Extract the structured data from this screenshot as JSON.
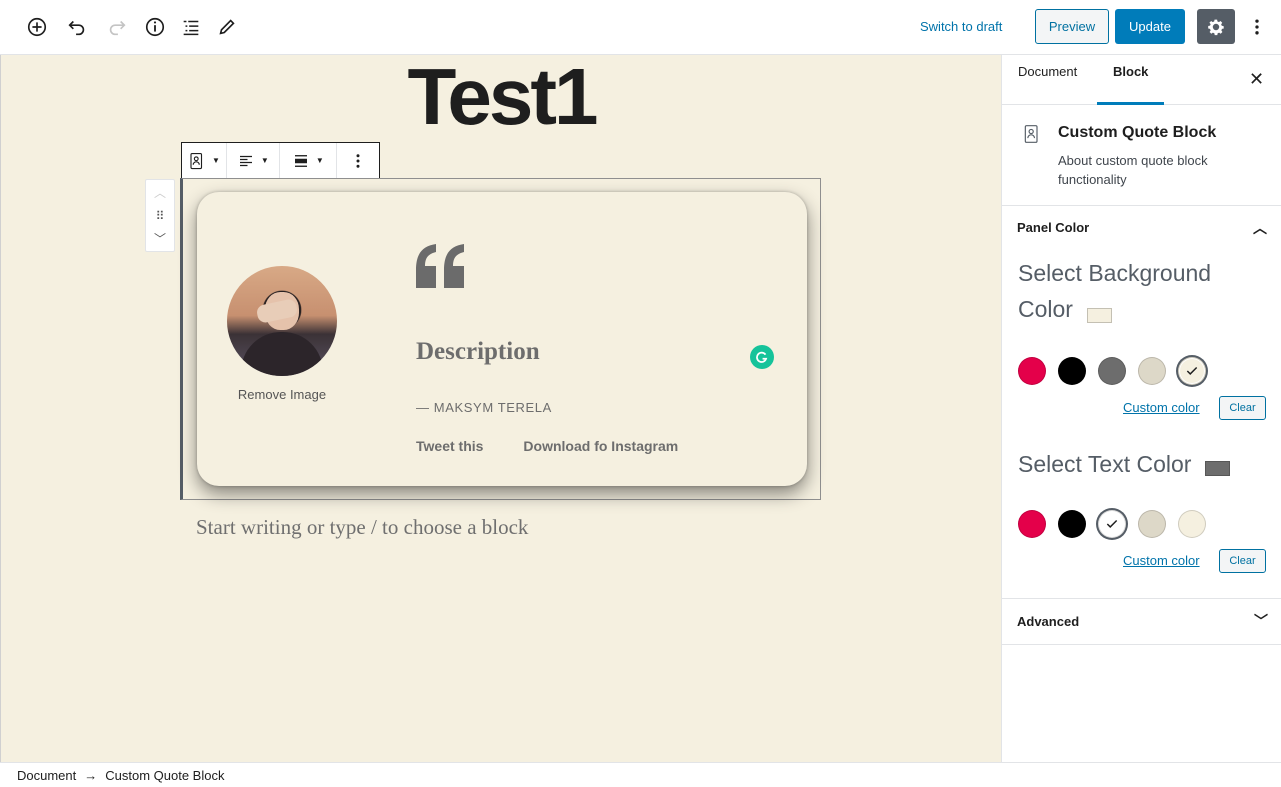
{
  "toolbar": {
    "switch_draft": "Switch to draft",
    "preview": "Preview",
    "update": "Update"
  },
  "editor": {
    "post_title": "Test1",
    "placeholder": "Start writing or type / to choose a block"
  },
  "quote_block": {
    "remove_image": "Remove Image",
    "description": "Description",
    "author": "— MAKSYM TERELA",
    "tweet_link": "Tweet this",
    "instagram_link": "Download fo Instagram"
  },
  "sidebar": {
    "tabs": [
      "Document",
      "Block"
    ],
    "active_tab": "Block",
    "block_name": "Custom Quote Block",
    "block_description": "About custom quote block functionality",
    "panel_color_title": "Panel Color",
    "bg_color_title": "Select Background Color",
    "text_color_title": "Select Text Color",
    "custom_color_label": "Custom color",
    "clear_label": "Clear",
    "advanced_title": "Advanced",
    "palette": [
      "#e4004a",
      "#000000",
      "#6d6d6d",
      "#ddd8c8",
      "#f5f0e0"
    ],
    "selected_background": "#f5f0e0",
    "selected_text": "#6d6d6d"
  },
  "breadcrumb": {
    "root": "Document",
    "current": "Custom Quote Block"
  }
}
